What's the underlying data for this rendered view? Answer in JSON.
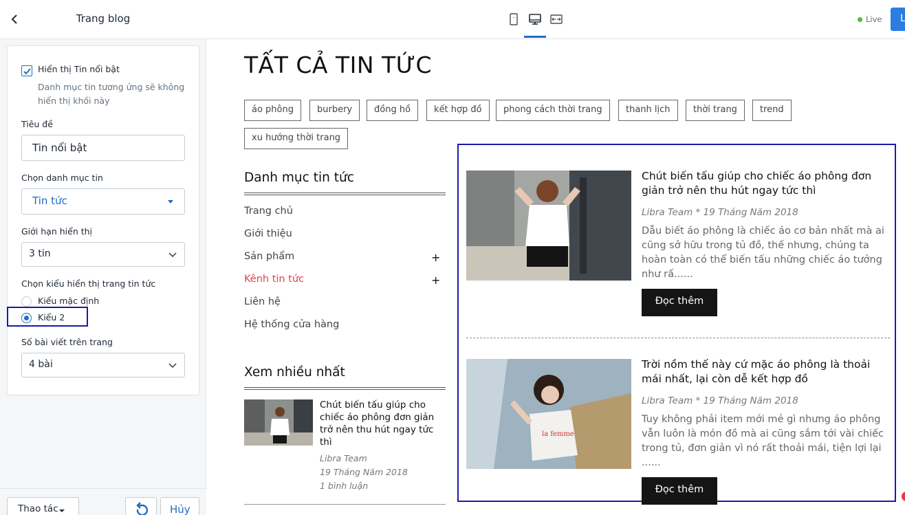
{
  "panel": {
    "title": "Trang blog",
    "show_featured_label": "Hiển thị Tin nổi bật",
    "show_featured_hint": "Danh mục tin tương ứng sẽ không hiển thị khối này",
    "title_label": "Tiêu đề",
    "title_value": "Tin nổi bật",
    "category_label": "Chọn danh mục tin",
    "category_value": "Tin tức",
    "limit_label": "Giới hạn hiển thị",
    "limit_value": "3 tin",
    "style_label": "Chọn kiểu hiển thị trang tin tức",
    "style_options": [
      "Kiểu mặc định",
      "Kiểu 2"
    ],
    "posts_per_page_label": "Số bài viết trên trang",
    "posts_per_page_value": "4 bài",
    "actions_label": "Thao tác",
    "cancel_label": "Hủy"
  },
  "topbar": {
    "live_label": "Live",
    "save_label": "L"
  },
  "preview": {
    "page_title": "TẤT CẢ TIN TỨC",
    "tags": [
      "áo phông",
      "burbery",
      "đồng hồ",
      "kết hợp đồ",
      "phong cách thời trang",
      "thanh lịch",
      "thời trang",
      "trend",
      "xu hướng thời trang"
    ],
    "category_heading": "Danh mục tin tức",
    "menu": [
      "Trang chủ",
      "Giới thiệu",
      "Sản phẩm",
      "Kênh tin tức",
      "Liên hệ",
      "Hệ thống cửa hàng"
    ],
    "most_viewed_heading": "Xem nhiều nhất",
    "mini_post": {
      "title": "Chút biến tấu giúp cho chiếc áo phông đơn giản trở nên thu hút ngay tức thì",
      "author": "Libra Team",
      "date": "19 Tháng Năm 2018",
      "comments": "1 bình luận"
    },
    "posts": [
      {
        "title": "Chút biến tấu giúp cho chiếc áo phông đơn giản trở nên thu hút ngay tức thì",
        "meta": "Libra Team  *  19 Tháng Năm 2018",
        "excerpt": "Dẫu biết áo phông là chiếc áo cơ bản nhất mà ai cũng sở hữu trong tủ đồ, thế nhưng, chúng ta hoàn toàn có thể biến tấu những chiếc áo tưởng như rấ......",
        "button": "Đọc thêm"
      },
      {
        "title": "Trời nồm thế này cứ mặc áo phông là thoải mái nhất, lại còn dễ kết hợp đồ",
        "meta": "Libra Team  *  19 Tháng Năm 2018",
        "excerpt": "Tuy không phải item mới mẻ gì nhưng áo phông vẫn luôn là món đồ mà ai cũng sắm tới vài chiếc trong tủ, đơn giản vì nó rất thoải mái, tiện lợi lại ......",
        "button": "Đọc thêm"
      }
    ]
  },
  "colors": {
    "accent": "#1f6cc4",
    "highlight_frame": "#1a1aa8",
    "menu_active": "#e0424e",
    "button_dark": "#151515"
  }
}
